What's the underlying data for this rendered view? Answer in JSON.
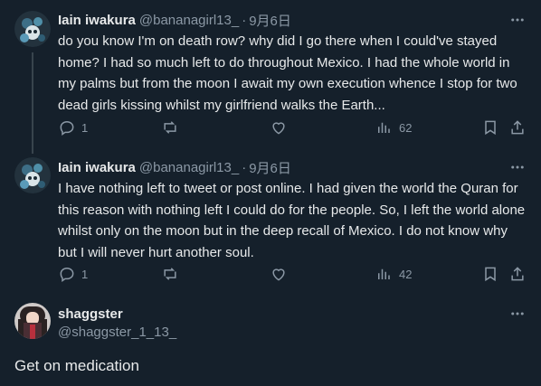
{
  "tweets": [
    {
      "author_name": "Iain iwakura",
      "handle": "@bananagirl13_",
      "separator": "·",
      "date": "9月6日",
      "text": "do you know I'm on death row? why did I go there when I could've stayed home? I had so much left to do throughout Mexico. I had the whole world in my palms but from the moon I await my own execution whence I stop for two dead girls kissing whilst my girlfriend walks the Earth...",
      "replies": "1",
      "views": "62",
      "avatar_icon": "skull-flower-avatar"
    },
    {
      "author_name": "Iain iwakura",
      "handle": "@bananagirl13_",
      "separator": "·",
      "date": "9月6日",
      "text": "I have nothing left to tweet or post online. I had given the world the Quran for this reason with nothing left I could do for the people. So, I left the world alone whilst only on the moon but in the deep recall of Mexico. I do not know why but I will never hurt another soul.",
      "replies": "1",
      "views": "42",
      "avatar_icon": "skull-flower-avatar"
    }
  ],
  "reply": {
    "author_name": "shaggster",
    "handle": "@shaggster_1_13_",
    "text": "Get on medication"
  },
  "colors": {
    "background": "#15202b",
    "text": "#e7e9ea",
    "muted": "#8b98a5",
    "thread_line": "#38444d"
  },
  "icons": [
    "more-icon",
    "reply-icon",
    "retweet-icon",
    "like-icon",
    "views-icon",
    "bookmark-icon",
    "share-icon"
  ]
}
